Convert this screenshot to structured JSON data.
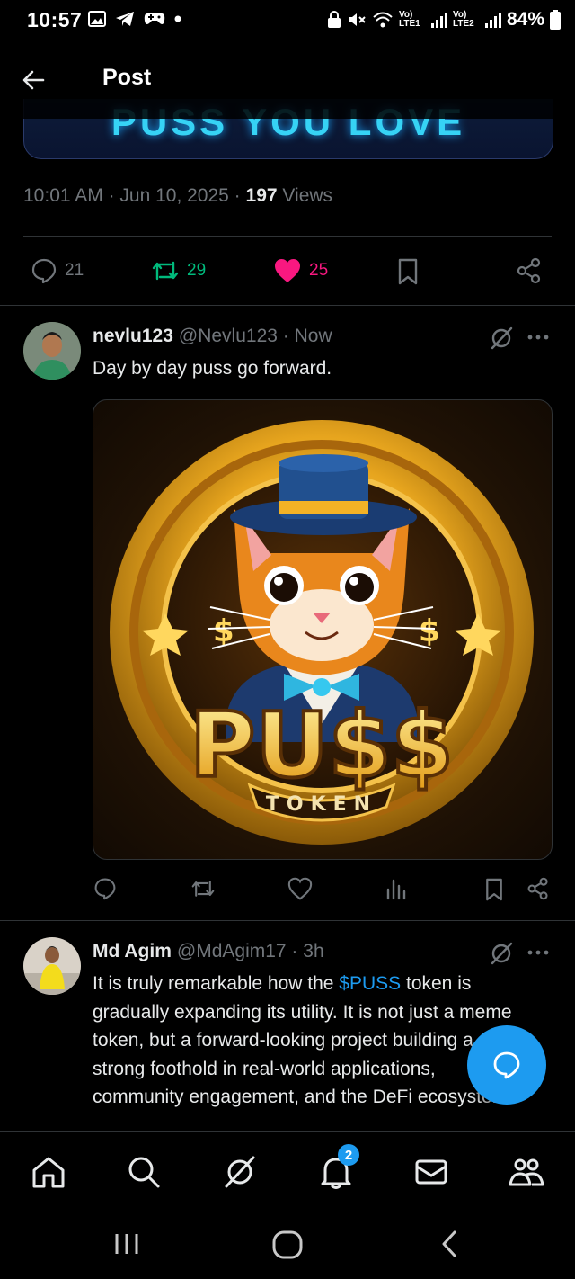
{
  "status_bar": {
    "time": "10:57",
    "battery": "84%",
    "sim1": "Vo) LTE1",
    "sim2": "Vo) LTE2",
    "left_icons": [
      "gallery-icon",
      "telegram-icon",
      "game-controller-icon",
      "dot-icon"
    ],
    "right_icons": [
      "lock-icon",
      "mute-icon",
      "wifi-icon",
      "signal-icon",
      "signal-icon",
      "battery-icon"
    ]
  },
  "header": {
    "title": "Post"
  },
  "banner": {
    "text": "PUSS YOU LOVE"
  },
  "post_meta": {
    "time": "10:01 AM",
    "date": "Jun 10, 2025",
    "views_count": "197",
    "views_label": "Views"
  },
  "post_actions": {
    "replies": "21",
    "reposts": "29",
    "likes": "25"
  },
  "reply1": {
    "display_name": "nevlu123",
    "handle": "@Nevlu123",
    "time": "Now",
    "text": "Day by day puss go forward.",
    "image": {
      "word": "PU$$",
      "subword": "TOKEN"
    }
  },
  "reply2": {
    "display_name": "Md Agim",
    "handle": "@MdAgim17",
    "time": "3h",
    "text_before": "It is truly remarkable how the ",
    "cashtag": "$PUSS",
    "text_after": " token is gradually expanding its utility. It is not just a meme token, but a forward-looking project building a strong foothold in real-world applications, community engagement, and the DeFi ecosystem."
  },
  "bottom_nav": {
    "notification_count": "2"
  },
  "colors": {
    "accent": "#1d9bf0",
    "repost": "#00ba7c",
    "like": "#f91880",
    "muted": "#71767b"
  }
}
